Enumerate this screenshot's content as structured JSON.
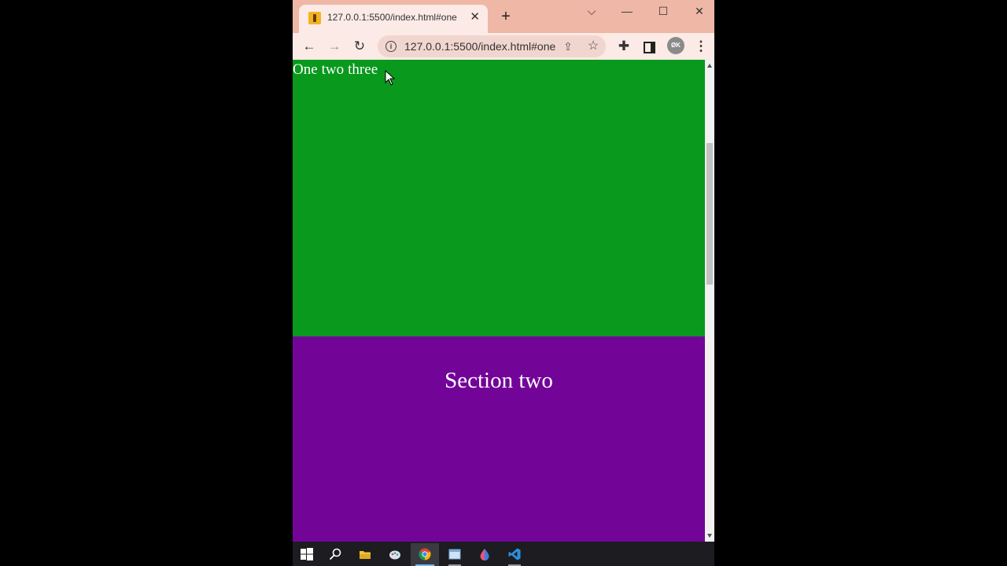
{
  "browser": {
    "tab": {
      "title": "127.0.0.1:5500/index.html#one",
      "close": "✕"
    },
    "new_tab": "+",
    "window_controls": {
      "dropdown": "⌵",
      "minimize": "—",
      "maximize": "☐",
      "close": "✕"
    },
    "toolbar": {
      "back": "←",
      "forward": "→",
      "reload": "↻",
      "url": "127.0.0.1:5500/index.html#one",
      "info": "i",
      "share": "⇪",
      "star": "☆",
      "extensions": "✚",
      "profile_initials": "ØK",
      "menu": "⋮"
    }
  },
  "page": {
    "nav_links": [
      "One",
      "two",
      "three"
    ],
    "section_two_title": "Section two",
    "colors": {
      "section_one": "#08991d",
      "section_two": "#730498",
      "text": "#ffffff"
    }
  },
  "taskbar": {
    "items": [
      "windows-start-icon",
      "search-icon",
      "file-explorer-icon",
      "paint-icon",
      "chrome-icon",
      "app-window-icon",
      "color-drop-icon",
      "vscode-icon"
    ]
  }
}
